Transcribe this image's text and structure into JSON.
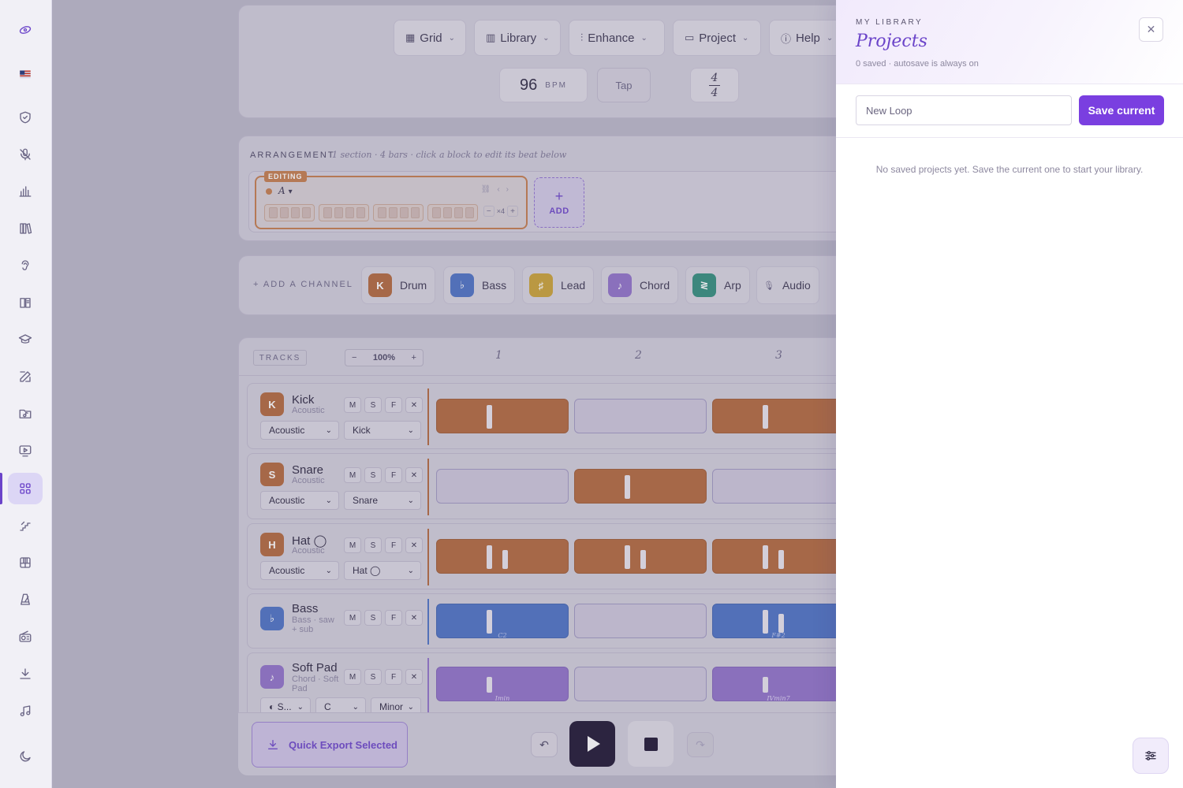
{
  "rail": {
    "items": [
      "logo-icon",
      "flag-icon",
      "shield-icon",
      "mic-off-icon",
      "bar-chart-icon",
      "books-icon",
      "ear-icon",
      "book-open-icon",
      "graduation-cap-icon",
      "edit-icon",
      "folder-music-icon",
      "monitor-play-icon",
      "grid-icon",
      "staircase-icon",
      "piano-icon",
      "metronome-icon",
      "radio-icon",
      "download-icon",
      "music-note-icon",
      "moon-icon"
    ],
    "active": "grid-icon",
    "accent": "#6b44c9"
  },
  "toolbar": {
    "grid_label": "Grid",
    "library_label": "Library",
    "enhance_label": "Enhance",
    "project_label": "Project",
    "help_label": "Help",
    "bpm_value": "96",
    "bpm_unit": "BPM",
    "tap_label": "Tap",
    "time_sig_top": "4",
    "time_sig_bottom": "4"
  },
  "arrangement": {
    "title": "ARRANGEMENT",
    "subtitle": "1 section · 4 bars · click a block to edit its beat below",
    "editing_tag": "EDITING",
    "section_name": "A",
    "repeat_label": "×4",
    "add_label": "ADD"
  },
  "channels": {
    "label": "+ ADD A CHANNEL",
    "items": [
      {
        "badge": "K",
        "label": "Drum",
        "color": "#b0663a"
      },
      {
        "badge": "♭",
        "label": "Bass",
        "color": "#4a6fc2"
      },
      {
        "badge": "♯",
        "label": "Lead",
        "color": "#c9a032"
      },
      {
        "badge": "♪",
        "label": "Chord",
        "color": "#8e70c7"
      },
      {
        "badge": "≷",
        "label": "Arp",
        "color": "#2f8c7a"
      },
      {
        "badge": "🎙",
        "label": "Audio",
        "color": "transparent"
      }
    ]
  },
  "tracks": {
    "tag": "TRACKS",
    "zoom_minus": "−",
    "zoom_value": "100%",
    "zoom_plus": "+",
    "bar_numbers": [
      "1",
      "2",
      "3"
    ],
    "msf": [
      "M",
      "S",
      "F"
    ],
    "rows": [
      {
        "badge": "K",
        "name": "Kick",
        "sub": "Acoustic",
        "sel1": "Acoustic",
        "sel2": "Kick"
      },
      {
        "badge": "S",
        "name": "Snare",
        "sub": "Acoustic",
        "sel1": "Acoustic",
        "sel2": "Snare"
      },
      {
        "badge": "H",
        "name": "Hat ◯",
        "sub": "Acoustic",
        "sel1": "Acoustic",
        "sel2": "Hat ◯"
      },
      {
        "badge": "♭",
        "name": "Bass",
        "sub": "Bass · saw + sub"
      },
      {
        "badge": "♪",
        "name": "Soft Pad",
        "sub": "Chord · Soft Pad",
        "sel1": "◐ S...",
        "sel2": "C",
        "sel3": "Minor"
      }
    ],
    "clip_labels": [
      "C2",
      "F#2",
      "Imin",
      "IVmin7"
    ]
  },
  "transport": {
    "quick_export_label": "Quick Export Selected"
  },
  "drawer": {
    "eyebrow": "MY LIBRARY",
    "title": "Projects",
    "subtitle": "0 saved · autosave is always on",
    "input_placeholder": "New Loop",
    "save_label": "Save current",
    "empty_text": "No saved projects yet. Save the current one to start your library."
  }
}
